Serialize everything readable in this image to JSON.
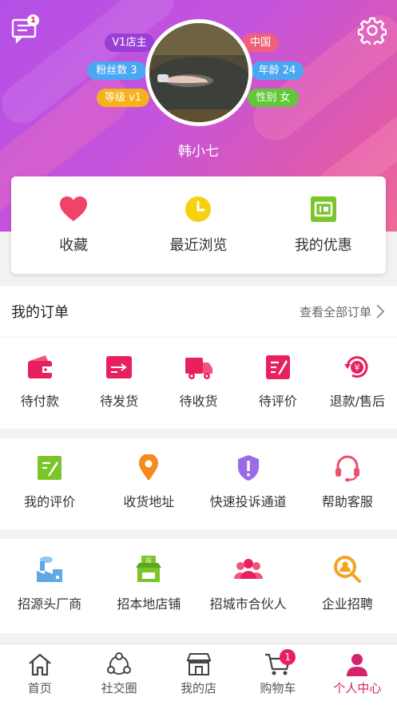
{
  "header": {
    "chat_badge": "1",
    "username": "韩小七",
    "tags_left": [
      "V1店主",
      "粉丝数 3",
      "等级 v1"
    ],
    "tags_right": [
      "中国",
      "年龄 24",
      "性别 女"
    ]
  },
  "quick": [
    {
      "label": "收藏",
      "icon": "heart-icon"
    },
    {
      "label": "最近浏览",
      "icon": "clock-icon"
    },
    {
      "label": "我的优惠",
      "icon": "coupon-icon"
    }
  ],
  "orders": {
    "title": "我的订单",
    "view_all": "查看全部订单",
    "items": [
      {
        "label": "待付款",
        "icon": "wallet-icon"
      },
      {
        "label": "待发货",
        "icon": "ship-box-icon"
      },
      {
        "label": "待收货",
        "icon": "truck-icon"
      },
      {
        "label": "待评价",
        "icon": "review-icon"
      },
      {
        "label": "退款/售后",
        "icon": "refund-icon"
      }
    ]
  },
  "services": [
    {
      "label": "我的评价",
      "icon": "edit-icon"
    },
    {
      "label": "收货地址",
      "icon": "location-icon"
    },
    {
      "label": "快速投诉通道",
      "icon": "complaint-shield-icon"
    },
    {
      "label": "帮助客服",
      "icon": "headset-icon"
    }
  ],
  "recruit": [
    {
      "label": "招源头厂商",
      "icon": "factory-icon"
    },
    {
      "label": "招本地店铺",
      "icon": "shop-icon"
    },
    {
      "label": "招城市合伙人",
      "icon": "partners-icon"
    },
    {
      "label": "企业招聘",
      "icon": "search-person-icon"
    }
  ],
  "tabbar": {
    "cart_badge": "1",
    "items": [
      {
        "label": "首页",
        "icon": "home-icon"
      },
      {
        "label": "社交圈",
        "icon": "social-icon"
      },
      {
        "label": "我的店",
        "icon": "store-icon"
      },
      {
        "label": "购物车",
        "icon": "cart-icon"
      },
      {
        "label": "个人中心",
        "icon": "user-icon"
      }
    ]
  }
}
